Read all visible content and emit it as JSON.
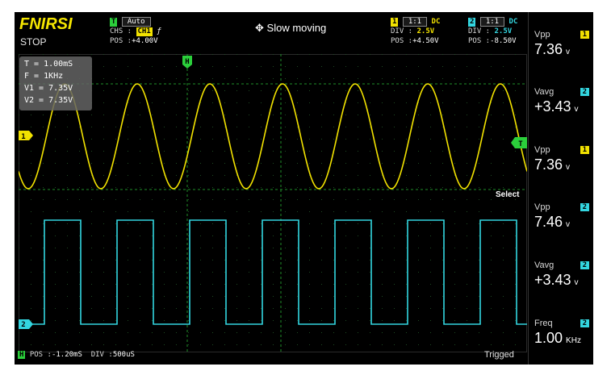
{
  "header": {
    "brand": "FNIRSI",
    "run_state": "STOP",
    "trigger_mode_badge": "T",
    "trigger_mode": "Auto",
    "chs_label": "CHS :",
    "chs_value": "CH1",
    "edge_icon": "rising-edge-icon",
    "pos_label": "POS :",
    "pos_value": "+4.00V",
    "status": "Slow moving",
    "status_icon": "move-arrows-icon"
  },
  "channel1": {
    "badge": "1",
    "probe": "1:1",
    "coupling": "DC",
    "div_label": "DIV :",
    "div_value": "2.5V",
    "pos_label": "POS :",
    "pos_value": "+4.50V",
    "color": "#f2e200"
  },
  "channel2": {
    "badge": "2",
    "probe": "1:1",
    "coupling": "DC",
    "div_label": "DIV :",
    "div_value": "2.5V",
    "pos_label": "POS :",
    "pos_value": "-8.50V",
    "color": "#33d6e0"
  },
  "info": {
    "t": "T = 1.00mS",
    "f": "F = 1KHz",
    "v1": "V1 = 7.35V",
    "v2": "V2 = 7.35V"
  },
  "markers": {
    "h": "H",
    "ch1": "1",
    "ch2": "2",
    "trigger": "T"
  },
  "select_label": "Select",
  "measurements": [
    {
      "label": "Vpp",
      "channel": "1",
      "value": "7.36",
      "unit": "v"
    },
    {
      "label": "Vavg",
      "channel": "2",
      "value": "+3.43",
      "unit": "v"
    },
    {
      "label": "Vpp",
      "channel": "1",
      "value": "7.36",
      "unit": "v"
    },
    {
      "label": "Vpp",
      "channel": "2",
      "value": "7.46",
      "unit": "v"
    },
    {
      "label": "Vavg",
      "channel": "2",
      "value": "+3.43",
      "unit": "v"
    },
    {
      "label": "Freq",
      "channel": "2",
      "value": "1.00",
      "unit": "KHz"
    }
  ],
  "timebase": {
    "badge": "H",
    "pos_label": "POS :",
    "pos_value": "-1.20mS",
    "div_label": "DIV :",
    "div_value": "500uS"
  },
  "trigger_status": "Trigged",
  "waveforms": {
    "ch1_cycles_visible": 7,
    "ch2_cycles_visible": 7,
    "grid_color": "#1f8f2a"
  }
}
